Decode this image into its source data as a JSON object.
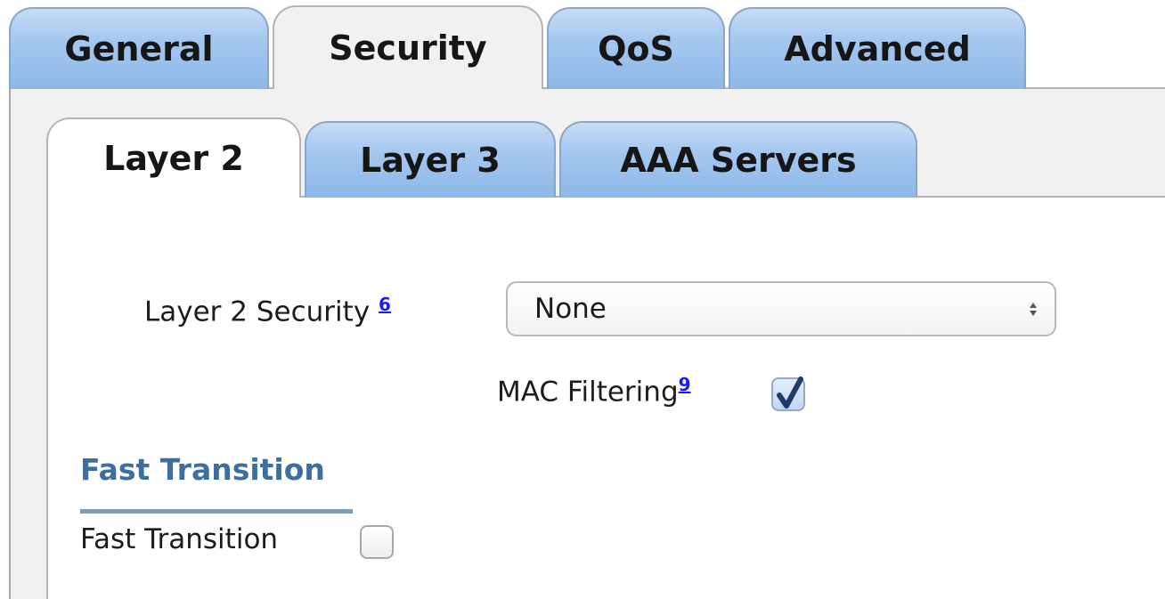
{
  "main_tabs": [
    {
      "label": "General",
      "active": false
    },
    {
      "label": "Security",
      "active": true
    },
    {
      "label": "QoS",
      "active": false
    },
    {
      "label": "Advanced",
      "active": false
    }
  ],
  "sub_tabs": [
    {
      "label": "Layer 2",
      "active": true
    },
    {
      "label": "Layer 3",
      "active": false
    },
    {
      "label": "AAA Servers",
      "active": false
    }
  ],
  "layer2_security": {
    "label": "Layer 2 Security",
    "help_ref": "6",
    "selected_value": "None"
  },
  "mac_filtering": {
    "label": "MAC Filtering",
    "help_ref": "9",
    "checked": true
  },
  "fast_transition_section": {
    "heading": "Fast Transition",
    "field_label": "Fast Transition",
    "checked": false
  },
  "colors": {
    "tab_blue": "#a4c7ef",
    "tab_active": "#f1f1f1",
    "section_heading": "#3c6fa0",
    "help_link": "#1a1aff",
    "checkmark": "#1f3a6b"
  }
}
